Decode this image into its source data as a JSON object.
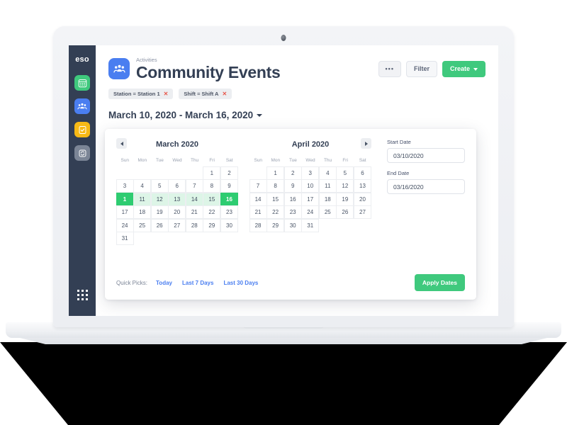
{
  "sidebar": {
    "logo": "eso",
    "items": [
      {
        "name": "calendar-grid",
        "color": "#3fc97d"
      },
      {
        "name": "people-active",
        "color": "#4a7ef0"
      },
      {
        "name": "checklist",
        "color": "#f7b916"
      },
      {
        "name": "refresh",
        "color": "#7b8596"
      }
    ],
    "launcher": "app-launcher"
  },
  "header": {
    "breadcrumb": "Activities",
    "title": "Community Events",
    "buttons": {
      "more": "•••",
      "filter": "Filter",
      "create": "Create"
    }
  },
  "chips": [
    {
      "label": "Station = Station 1",
      "remove": "✕"
    },
    {
      "label": "Shift = Shift A",
      "remove": "✕"
    }
  ],
  "range": {
    "title": "March 10, 2020 - March 16, 2020"
  },
  "picker": {
    "calendars": [
      {
        "title": "March 2020",
        "dow": [
          "Sun",
          "Mon",
          "Tue",
          "Wed",
          "Thu",
          "Fri",
          "Sat"
        ],
        "weeks": [
          [
            "",
            "",
            "",
            "",
            "",
            "1",
            "2"
          ],
          [
            "3",
            "4",
            "5",
            "6",
            "7",
            "8",
            "9"
          ],
          [
            "1",
            "11",
            "12",
            "13",
            "14",
            "15",
            "16"
          ],
          [
            "17",
            "18",
            "19",
            "20",
            "21",
            "22",
            "23"
          ],
          [
            "24",
            "25",
            "26",
            "27",
            "28",
            "29",
            "30"
          ],
          [
            "31",
            "",
            "",
            "",
            "",
            "",
            ""
          ]
        ],
        "range_week": 2,
        "range_start_col": 0,
        "range_end_col": 6
      },
      {
        "title": "April 2020",
        "dow": [
          "Sun",
          "Mon",
          "Tue",
          "Wed",
          "Thu",
          "Fri",
          "Sat"
        ],
        "weeks": [
          [
            "",
            "1",
            "2",
            "3",
            "4",
            "5",
            "6"
          ],
          [
            "7",
            "8",
            "9",
            "10",
            "11",
            "12",
            "13"
          ],
          [
            "14",
            "15",
            "16",
            "17",
            "18",
            "19",
            "20"
          ],
          [
            "21",
            "22",
            "23",
            "24",
            "25",
            "26",
            "27"
          ],
          [
            "28",
            "29",
            "30",
            "31",
            "",
            "",
            ""
          ]
        ],
        "range_week": -1,
        "range_start_col": -1,
        "range_end_col": -1
      }
    ],
    "fields": {
      "start_label": "Start Date",
      "start_value": "03/10/2020",
      "end_label": "End Date",
      "end_value": "03/16/2020"
    },
    "footer": {
      "quick_label": "Quick Picks:",
      "links": [
        "Today",
        "Last 7 Days",
        "Last 30 Days"
      ],
      "apply": "Apply Dates"
    }
  },
  "colors": {
    "sidebar": "#333f54",
    "accent_green": "#3fc97d",
    "range_fill": "#ddf5e7",
    "edge_green": "#2ecc71",
    "link_blue": "#4a7ef0",
    "chip_x_red": "#e8584c"
  }
}
